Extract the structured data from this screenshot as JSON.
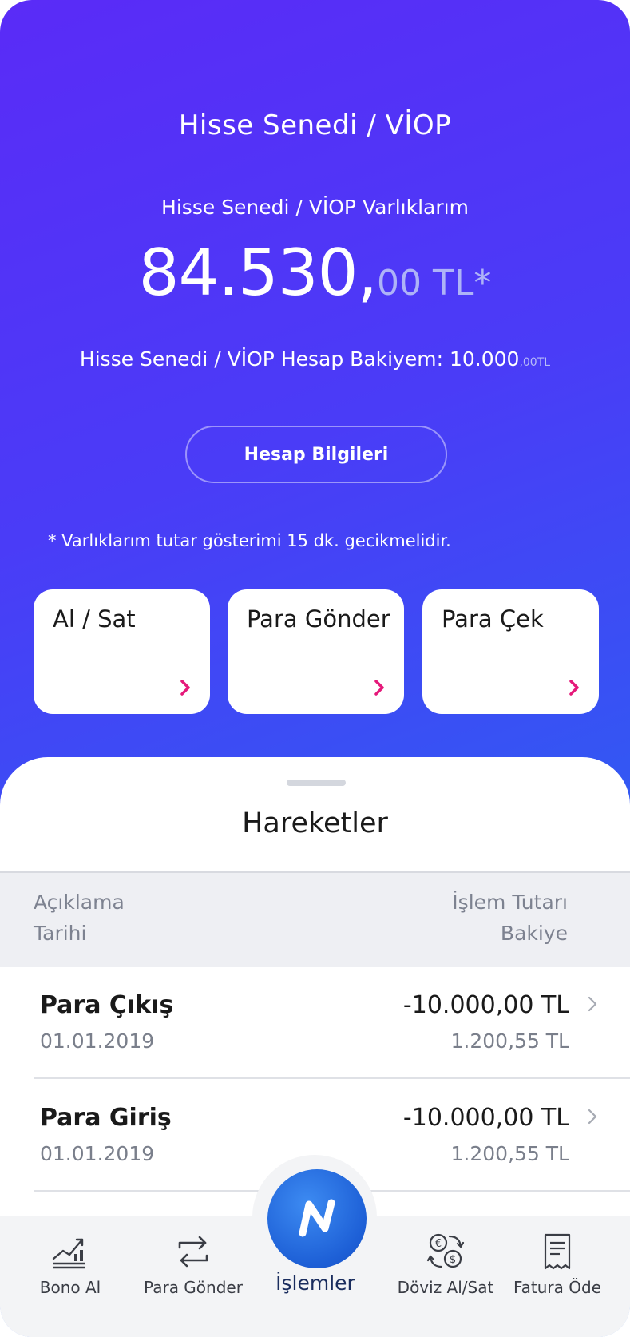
{
  "hero": {
    "title": "Hisse Senedi / VİOP",
    "assets_label": "Hisse Senedi / VİOP Varlıklarım",
    "amount_main": "84.530,",
    "amount_decimal": "00 TL*",
    "balance_label": "Hisse Senedi / VİOP Hesap Bakiyem: 10.000",
    "balance_decimal": ",00TL",
    "info_button": "Hesap Bilgileri",
    "footnote": "* Varlıklarım tutar gösterimi 15 dk. gecikmelidir."
  },
  "actions": [
    {
      "label": "Al / Sat"
    },
    {
      "label": "Para Gönder"
    },
    {
      "label": "Para Çek"
    }
  ],
  "transactions": {
    "title": "Hareketler",
    "header": {
      "left_top": "Açıklama",
      "left_bottom": "Tarihi",
      "right_top": "İşlem Tutarı",
      "right_bottom": "Bakiye"
    },
    "rows": [
      {
        "name": "Para Çıkış",
        "date": "01.01.2019",
        "amount": "-10.000,00 TL",
        "balance": "1.200,55 TL"
      },
      {
        "name": "Para Giriş",
        "date": "01.01.2019",
        "amount": "-10.000,00 TL",
        "balance": "1.200,55 TL"
      }
    ]
  },
  "tabbar": {
    "items": [
      {
        "label": "Bono Al",
        "icon": "chart-icon"
      },
      {
        "label": "Para Gönder",
        "icon": "transfer-icon"
      },
      {
        "label": "İşlemler",
        "icon": "n-logo-icon"
      },
      {
        "label": "Döviz Al/Sat",
        "icon": "currency-exchange-icon"
      },
      {
        "label": "Fatura Öde",
        "icon": "receipt-icon"
      }
    ]
  },
  "colors": {
    "accent_pink": "#e5197a",
    "gradient_start": "#5a2bf7",
    "gradient_end": "#2b74ee",
    "center_button": "#1d5fd6"
  }
}
